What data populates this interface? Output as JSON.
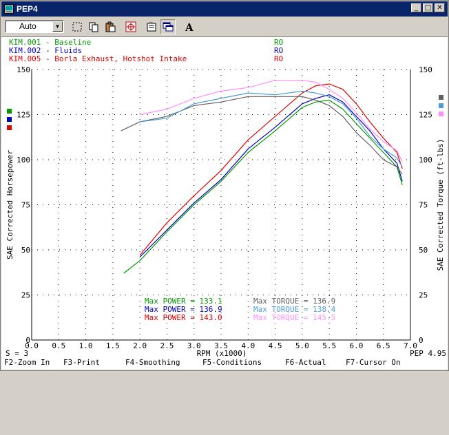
{
  "window": {
    "title": "PEP4"
  },
  "toolbar": {
    "combo_value": "Auto"
  },
  "legend": [
    {
      "label": "KIM.001 - Baseline",
      "code": "RO",
      "color": "#009a00"
    },
    {
      "label": "KIM.002 - Fluids",
      "code": "RO",
      "color": "#0000c0"
    },
    {
      "label": "KIM.005 - Borla Exhaust, Hotshot Intake",
      "code": "RO",
      "color": "#e00000"
    }
  ],
  "stats": {
    "power": [
      {
        "label": "Max POWER = 133.1",
        "color": "#009a00"
      },
      {
        "label": "Max POWER = 136.9",
        "color": "#0000c0"
      },
      {
        "label": "Max POWER = 143.0",
        "color": "#e00000"
      }
    ],
    "torque": [
      {
        "label": "Max TORQUE = 136.9",
        "color": "#606060"
      },
      {
        "label": "Max TORQUE = 138.4",
        "color": "#4a9ed6"
      },
      {
        "label": "Max TORQUE = 145.5",
        "color": "#ff90ff"
      }
    ]
  },
  "footer": {
    "smoothing": "S = 3",
    "version": "PEP 4.95"
  },
  "fkeys": [
    "F2-Zoom In",
    "F3-Print",
    "F4-Smoothing",
    "F5-Conditions",
    "F6-Actual",
    "F7-Cursor On"
  ],
  "chart_data": {
    "type": "line",
    "xlabel": "RPM (x1000)",
    "ylabel_left": "SAE Corrected Horsepower",
    "ylabel_right": "SAE Corrected Torque (ft-lbs)",
    "xlim": [
      0,
      7.0
    ],
    "ylim": [
      0,
      150
    ],
    "x_ticks": [
      "0.0",
      "0.5",
      "1.0",
      "1.5",
      "2.0",
      "2.5",
      "3.0",
      "3.5",
      "4.0",
      "4.5",
      "5.0",
      "5.5",
      "6.0",
      "6.5",
      "7.0"
    ],
    "y_ticks": [
      "0",
      "25",
      "50",
      "75",
      "100",
      "125",
      "150"
    ],
    "grid": "dotted",
    "series": [
      {
        "type": "power",
        "color": "#009a00",
        "x": [
          1.7,
          2.0,
          2.5,
          3.0,
          3.5,
          4.0,
          4.5,
          5.0,
          5.25,
          5.5,
          5.75,
          6.0,
          6.25,
          6.5,
          6.75,
          6.85
        ],
        "y": [
          37,
          44,
          60,
          75,
          88,
          104,
          116,
          129,
          132,
          133,
          128,
          120,
          112,
          104,
          96,
          86
        ]
      },
      {
        "type": "power",
        "color": "#0000c0",
        "x": [
          2.0,
          2.5,
          3.0,
          3.5,
          4.0,
          4.5,
          5.0,
          5.25,
          5.5,
          5.75,
          6.0,
          6.25,
          6.5,
          6.75,
          6.85
        ],
        "y": [
          46,
          61,
          76,
          89,
          106,
          118,
          131,
          134,
          136,
          132,
          124,
          116,
          106,
          98,
          88
        ]
      },
      {
        "type": "power",
        "color": "#e00000",
        "x": [
          2.0,
          2.5,
          3.0,
          3.5,
          4.0,
          4.5,
          5.0,
          5.25,
          5.5,
          5.75,
          6.0,
          6.25,
          6.5,
          6.75,
          6.85
        ],
        "y": [
          47,
          65,
          80,
          94,
          111,
          124,
          137,
          141,
          142,
          139,
          131,
          121,
          112,
          104,
          95
        ]
      },
      {
        "type": "torque",
        "color": "#606060",
        "x": [
          1.65,
          2.0,
          2.5,
          3.0,
          3.5,
          4.0,
          4.5,
          5.0,
          5.25,
          5.5,
          5.75,
          6.0,
          6.25,
          6.5,
          6.75,
          6.85
        ],
        "y": [
          116,
          121,
          124,
          130,
          132,
          135,
          135,
          135,
          133,
          130,
          124,
          115,
          108,
          100,
          96,
          92
        ]
      },
      {
        "type": "torque",
        "color": "#4a9ed6",
        "x": [
          2.0,
          2.5,
          3.0,
          3.5,
          4.0,
          4.5,
          5.0,
          5.25,
          5.5,
          5.75,
          6.0,
          6.25,
          6.5,
          6.75,
          6.85
        ],
        "y": [
          121,
          123,
          131,
          134,
          137,
          136,
          138,
          137,
          135,
          131,
          123,
          113,
          106,
          101,
          96
        ]
      },
      {
        "type": "torque",
        "color": "#ff90ff",
        "x": [
          2.0,
          2.5,
          3.0,
          3.5,
          4.0,
          4.5,
          5.0,
          5.25,
          5.5,
          5.75,
          6.0,
          6.25,
          6.5,
          6.75,
          6.85
        ],
        "y": [
          125,
          128,
          134,
          138,
          140,
          144,
          144,
          143,
          139,
          134,
          126,
          117,
          110,
          105,
          99
        ]
      }
    ]
  }
}
